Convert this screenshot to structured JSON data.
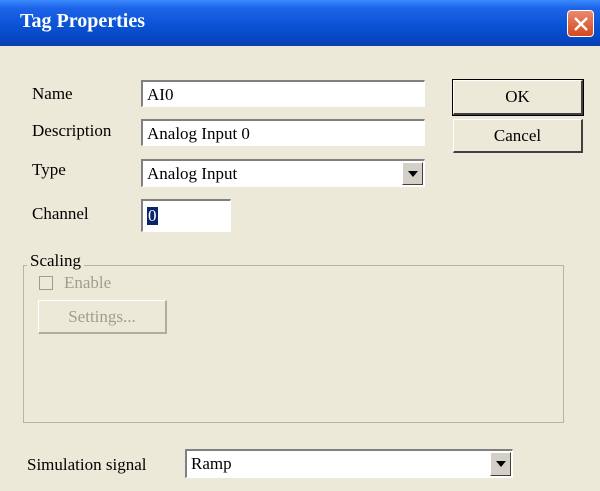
{
  "window": {
    "title": "Tag Properties"
  },
  "fields": {
    "name": {
      "label": "Name",
      "value": "AI0"
    },
    "description": {
      "label": "Description",
      "value": "Analog Input 0"
    },
    "type": {
      "label": "Type",
      "value": "Analog Input"
    },
    "channel": {
      "label": "Channel",
      "value": "0"
    }
  },
  "buttons": {
    "ok": "OK",
    "cancel": "Cancel"
  },
  "scaling": {
    "legend": "Scaling",
    "enable_label": "Enable",
    "enable_checked": false,
    "settings_label": "Settings..."
  },
  "simulation": {
    "label": "Simulation signal",
    "value": "Ramp"
  },
  "colors": {
    "titlebar": "#0a53d6",
    "dialog_bg": "#ece9d8",
    "close_button": "#d3481f"
  }
}
